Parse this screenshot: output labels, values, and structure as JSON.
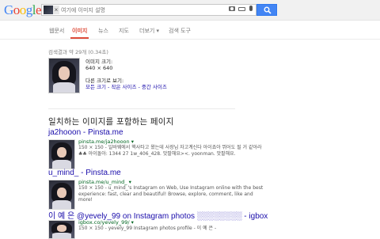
{
  "header": {
    "logo_text": "Google",
    "logo_colors": [
      "#4285f4",
      "#ea4335",
      "#fbbc05",
      "#4285f4",
      "#34a853",
      "#ea4335"
    ],
    "search_placeholder": "여기에 이미지 설명",
    "chip_close": "×"
  },
  "tabs": [
    {
      "label": "웹문서",
      "active": false
    },
    {
      "label": "이미지",
      "active": true
    },
    {
      "label": "뉴스",
      "active": false
    },
    {
      "label": "지도",
      "active": false
    },
    {
      "label": "더보기 ▾",
      "active": false
    },
    {
      "label": "검색 도구",
      "active": false
    }
  ],
  "stats": "검색결과 약 29개 (0.34초)",
  "image_info": {
    "size_label": "이미지 크기:",
    "size_value": "640 × 640",
    "other_sizes_label": "다른 크기로 보기:",
    "other_sizes_links": "모든 크기 - 작은 사이즈 - 중간 사이즈"
  },
  "section_title": "일치하는 이미지를 포함하는 페이지",
  "results": [
    {
      "title": "ja2hooon - Pinsta.me",
      "url": "pinsta.me/ja2hooon ▾",
      "desc": "150 × 150 - 일바웨에서 핵사타고 왔는데 사장님 자고계신다 아이죠아 뛰어도 될 거 같아라 ♣♣ 아이돌아: 1344 27 1w_406_428. 맛팔해요><. yoonman. 맛팔해요."
    },
    {
      "title": "u_mind_ - Pinsta.me",
      "url": "pinsta.me/u_mind_ ▾",
      "desc": "150 × 150 - u_mind_'s Instagram on Web, Use Instagram online with the best experience: fast, clear and beautiful! Browse, explore, comment, like and more!"
    },
    {
      "title": "이 예 은 @yevely_99 on Instagram photos ░░░░░░░░ - igbox",
      "url": "igbox.co/yevely_99/ ▾",
      "desc": "150 × 150 - yevely_99 Instagram photos profile - 이 예 은 -"
    }
  ]
}
